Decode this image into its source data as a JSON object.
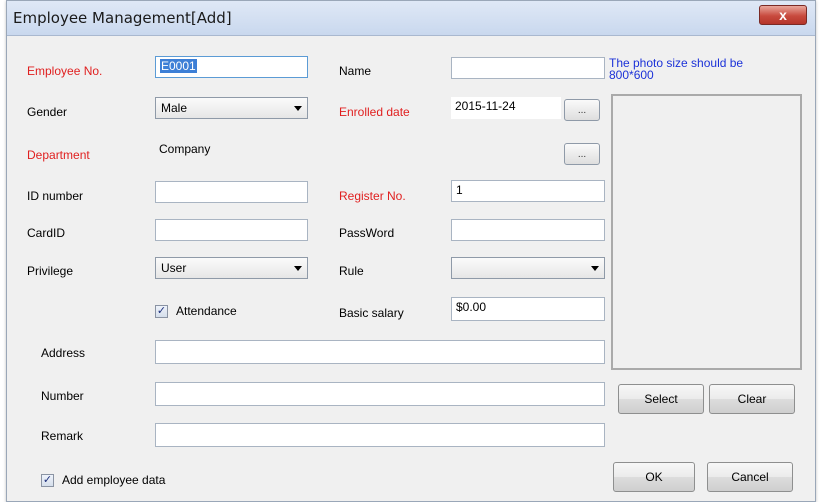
{
  "window": {
    "title": "Employee Management[Add]",
    "close_label": "x"
  },
  "fields": {
    "employee_no": {
      "label": "Employee No.",
      "value": "E0001"
    },
    "name": {
      "label": "Name",
      "value": ""
    },
    "gender": {
      "label": "Gender",
      "value": "Male"
    },
    "enrolled_date": {
      "label": "Enrolled date",
      "value": "2015-11-24"
    },
    "department": {
      "label": "Department",
      "value": "Company"
    },
    "id_number": {
      "label": "ID number",
      "value": ""
    },
    "register_no": {
      "label": "Register No.",
      "value": "1"
    },
    "card_id": {
      "label": "CardID",
      "value": ""
    },
    "password": {
      "label": "PassWord",
      "value": ""
    },
    "privilege": {
      "label": "Privilege",
      "value": "User"
    },
    "rule": {
      "label": "Rule",
      "value": ""
    },
    "attendance": {
      "label": "Attendance",
      "checked": true
    },
    "basic_salary": {
      "label": "Basic salary",
      "value": "$0.00"
    },
    "address": {
      "label": "Address",
      "value": ""
    },
    "number": {
      "label": "Number",
      "value": ""
    },
    "remark": {
      "label": "Remark",
      "value": ""
    }
  },
  "photo": {
    "hint": "The photo size should be 800*600",
    "select_label": "Select",
    "clear_label": "Clear"
  },
  "browse_label": "...",
  "footer": {
    "add_employee_label": "Add employee data",
    "add_employee_checked": true,
    "ok_label": "OK",
    "cancel_label": "Cancel"
  },
  "check_mark": "✓",
  "colors": {
    "required_label": "#e02020",
    "hint": "#1c32d8",
    "close_button": "#c84a3e"
  }
}
